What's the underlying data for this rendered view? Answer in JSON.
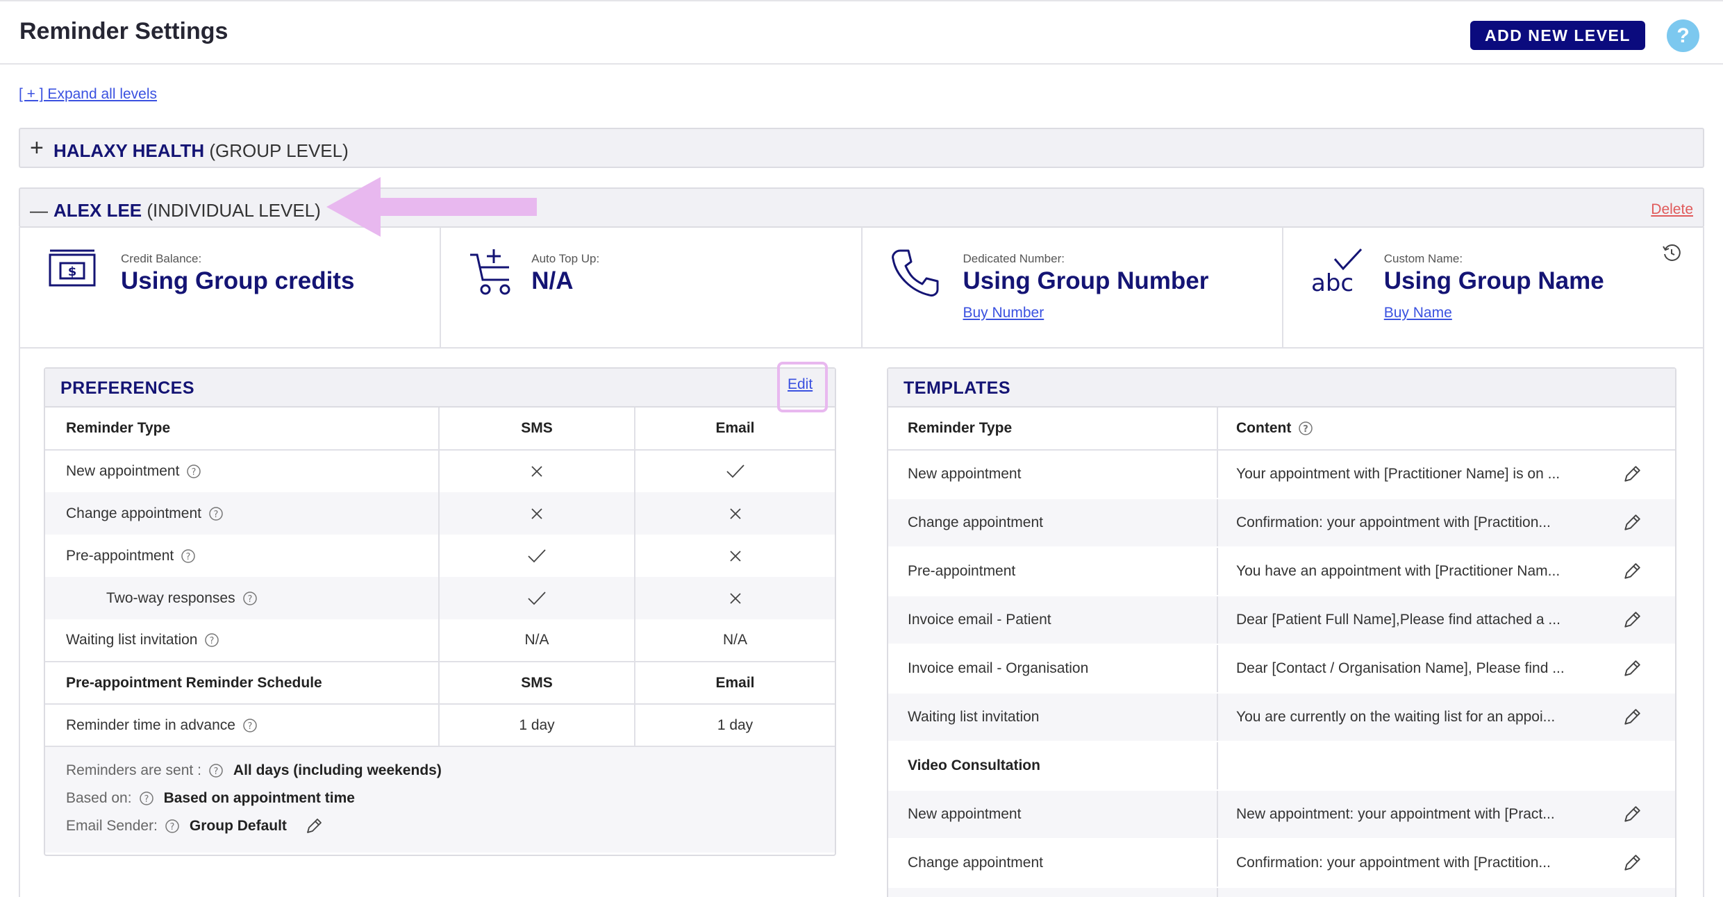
{
  "header": {
    "title": "Reminder Settings",
    "add_level_label": "ADD NEW LEVEL",
    "help_label": "?"
  },
  "expand_all_label": "[ + ] Expand all levels",
  "levels": [
    {
      "name": "HALAXY HEALTH",
      "type": "(GROUP LEVEL)",
      "toggle": "+"
    },
    {
      "name": "ALEX LEE",
      "type": "(INDIVIDUAL LEVEL)",
      "toggle": "—",
      "delete_label": "Delete"
    }
  ],
  "info": {
    "credit": {
      "label": "Credit Balance:",
      "value": "Using Group credits",
      "icon": "money-icon"
    },
    "topup": {
      "label": "Auto Top Up:",
      "value": "N/A",
      "icon": "cart-add-icon"
    },
    "number": {
      "label": "Dedicated Number:",
      "value": "Using Group Number",
      "link": "Buy Number",
      "icon": "phone-icon"
    },
    "name": {
      "label": "Custom Name:",
      "value": "Using Group Name",
      "link": "Buy Name",
      "icon": "abc-check-icon"
    }
  },
  "preferences": {
    "title": "PREFERENCES",
    "edit_label": "Edit",
    "header": {
      "type": "Reminder Type",
      "sms": "SMS",
      "email": "Email"
    },
    "rows": [
      {
        "type": "New appointment",
        "sms": "x",
        "email": "check"
      },
      {
        "type": "Change appointment",
        "sms": "x",
        "email": "x"
      },
      {
        "type": "Pre-appointment",
        "sms": "check",
        "email": "x"
      },
      {
        "type": "Two-way responses",
        "sms": "check",
        "email": "x"
      },
      {
        "type": "Waiting list invitation",
        "sms": "N/A",
        "email": "N/A"
      }
    ],
    "schedule_header": {
      "type": "Pre-appointment Reminder Schedule",
      "sms": "SMS",
      "email": "Email"
    },
    "schedule_row": {
      "type": "Reminder time in advance",
      "sms": "1 day",
      "email": "1 day"
    },
    "footer": {
      "sent_label": "Reminders are sent :",
      "sent_value": "All days (including weekends)",
      "based_label": "Based on:",
      "based_value": "Based on appointment time",
      "sender_label": "Email Sender:",
      "sender_value": "Group Default"
    }
  },
  "templates": {
    "title": "TEMPLATES",
    "header": {
      "type": "Reminder Type",
      "content": "Content"
    },
    "rows": [
      {
        "type": "New appointment",
        "content": "Your appointment with [Practitioner Name] is on ..."
      },
      {
        "type": "Change appointment",
        "content": "Confirmation: your appointment with [Practition..."
      },
      {
        "type": "Pre-appointment",
        "content": "You have an appointment with [Practitioner Nam..."
      },
      {
        "type": "Invoice email - Patient",
        "content": "Dear [Patient Full Name],Please find attached a ..."
      },
      {
        "type": "Invoice email - Organisation",
        "content": "Dear [Contact / Organisation Name], Please find ..."
      },
      {
        "type": "Waiting list invitation",
        "content": "You are currently on the waiting list for an appoi..."
      }
    ],
    "section_video": "Video Consultation",
    "video_rows": [
      {
        "type": "New appointment",
        "content": "New appointment: your appointment with [Pract..."
      },
      {
        "type": "Change appointment",
        "content": "Confirmation: your appointment with [Practition..."
      }
    ]
  },
  "colors": {
    "brand": "#0b0b7e",
    "link": "#3a51e0",
    "danger": "#e05a5a",
    "help": "#7cc8ef",
    "highlight": "#e8b8ef"
  }
}
